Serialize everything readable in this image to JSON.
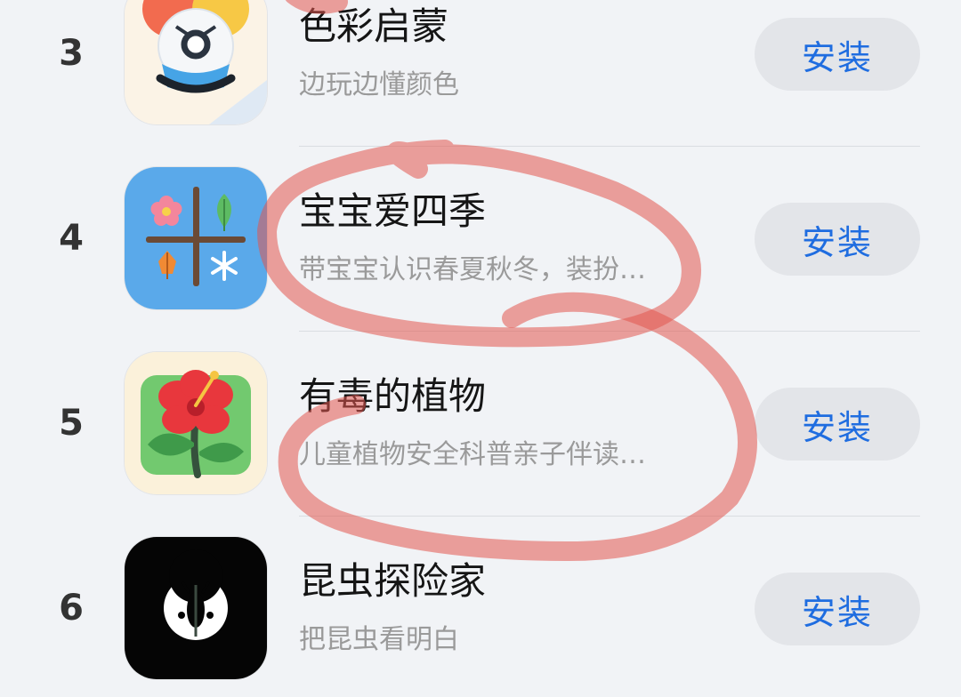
{
  "apps": [
    {
      "rank": "3",
      "title": "色彩启蒙",
      "desc": "边玩边懂颜色",
      "button": "安装",
      "icon": "color-enlightenment-icon"
    },
    {
      "rank": "4",
      "title": "宝宝爱四季",
      "desc": "带宝宝认识春夏秋冬，装扮…",
      "button": "安装",
      "icon": "four-seasons-icon"
    },
    {
      "rank": "5",
      "title": "有毒的植物",
      "desc": "儿童植物安全科普亲子伴读…",
      "button": "安装",
      "icon": "poisonous-plant-flower-icon"
    },
    {
      "rank": "6",
      "title": "昆虫探险家",
      "desc": "把昆虫看明白",
      "button": "安装",
      "icon": "insect-explorer-icon"
    }
  ],
  "colors": {
    "background": "#f1f3f6",
    "button_text": "#1f6de0",
    "button_bg": "#e3e5e9",
    "annotation": "#e2564f"
  }
}
